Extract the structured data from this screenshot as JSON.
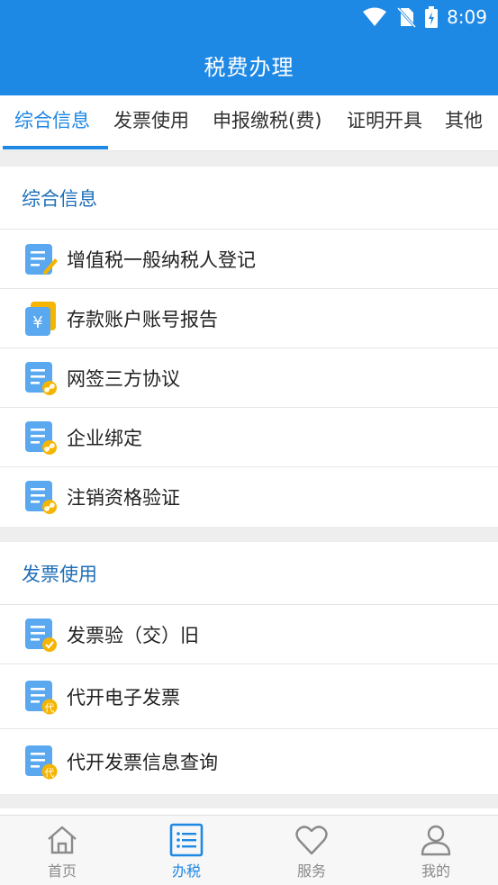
{
  "status_bar": {
    "time": "8:09"
  },
  "app_bar": {
    "title": "税费办理"
  },
  "tabs": [
    {
      "label": "综合信息",
      "active": true
    },
    {
      "label": "发票使用",
      "active": false
    },
    {
      "label": "申报缴税(费)",
      "active": false
    },
    {
      "label": "证明开具",
      "active": false
    },
    {
      "label": "其他",
      "active": false
    }
  ],
  "sections": [
    {
      "title": "综合信息",
      "items": [
        {
          "label": "增值税一般纳税人登记",
          "icon": "doc-edit-icon"
        },
        {
          "label": "存款账户账号报告",
          "icon": "yuan-card-icon"
        },
        {
          "label": "网签三方协议",
          "icon": "doc-link-icon"
        },
        {
          "label": "企业绑定",
          "icon": "doc-link-icon"
        },
        {
          "label": "注销资格验证",
          "icon": "doc-link-icon"
        }
      ]
    },
    {
      "title": "发票使用",
      "items": [
        {
          "label": "发票验（交）旧",
          "icon": "doc-check-icon"
        },
        {
          "label": "代开电子发票",
          "icon": "doc-dai-icon",
          "badge": "代"
        },
        {
          "label": "代开发票信息查询",
          "icon": "doc-dai-icon",
          "badge": "代"
        }
      ]
    }
  ],
  "bottom_nav": [
    {
      "label": "首页",
      "icon": "home-icon",
      "active": false
    },
    {
      "label": "办税",
      "icon": "list-icon",
      "active": true
    },
    {
      "label": "服务",
      "icon": "heart-icon",
      "active": false
    },
    {
      "label": "我的",
      "icon": "user-icon",
      "active": false
    }
  ],
  "colors": {
    "primary": "#1e88e5",
    "section_title": "#1e6fb8",
    "icon_blue": "#5aa8f0",
    "icon_badge": "#f5b400"
  }
}
